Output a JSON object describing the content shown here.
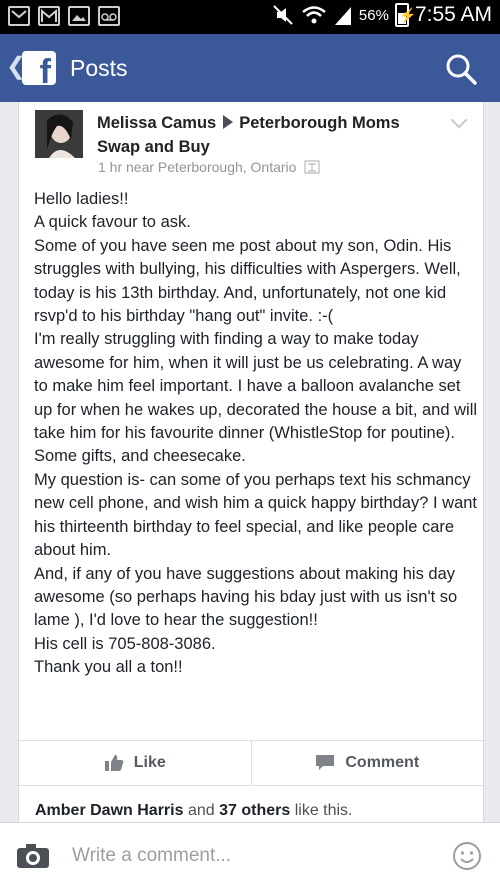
{
  "status_bar": {
    "battery": "56%",
    "time": "7:55 AM",
    "icons": [
      "email-notification-icon",
      "gmail-icon",
      "gallery-icon",
      "voicemail-icon",
      "mute-icon",
      "wifi-icon",
      "signal-icon",
      "battery-charging-icon"
    ]
  },
  "header": {
    "title": "Posts",
    "icons": [
      "back-chevron-icon",
      "facebook-logo-icon",
      "search-icon"
    ]
  },
  "post": {
    "author": "Melissa Camus",
    "group": "Peterborough Moms Swap and Buy",
    "meta": "1 hr near Peterborough, Ontario",
    "paragraphs": [
      "Hello ladies!!",
      "A quick favour to ask.",
      "Some of you have seen me post about my son, Odin. His struggles with bullying, his difficulties with Aspergers. Well, today is his 13th birthday. And, unfortunately, not one kid rsvp'd to his birthday \"hang out\" invite. :-(",
      "I'm really struggling with finding a way to make today awesome for him, when it will just be us celebrating. A way to make him feel important. I have a balloon avalanche set up for when he wakes up, decorated the house a bit, and will take him for his favourite dinner (WhistleStop for poutine). Some gifts, and cheesecake.",
      "My question is- can some of you perhaps text his schmancy new cell phone, and wish him a quick happy birthday? I want his thirteenth birthday to feel special, and like people care about him.",
      "And, if any of you have suggestions about making his day awesome (so perhaps having his bday just with us isn't so lame ), I'd love to hear the suggestion!!",
      "His cell is 705-808-3086.",
      "Thank you all a ton!!"
    ],
    "like_label": "Like",
    "comment_label": "Comment",
    "likes": {
      "name": "Amber Dawn Harris",
      "and": "and",
      "others": "37 others",
      "suffix": "like this."
    }
  },
  "composer": {
    "placeholder": "Write a comment...",
    "icons": [
      "camera-icon",
      "smiley-icon"
    ]
  },
  "colors": {
    "brand": "#3b5998",
    "background": "#e9eaee",
    "text": "#1d2129",
    "muted": "#90949c"
  }
}
